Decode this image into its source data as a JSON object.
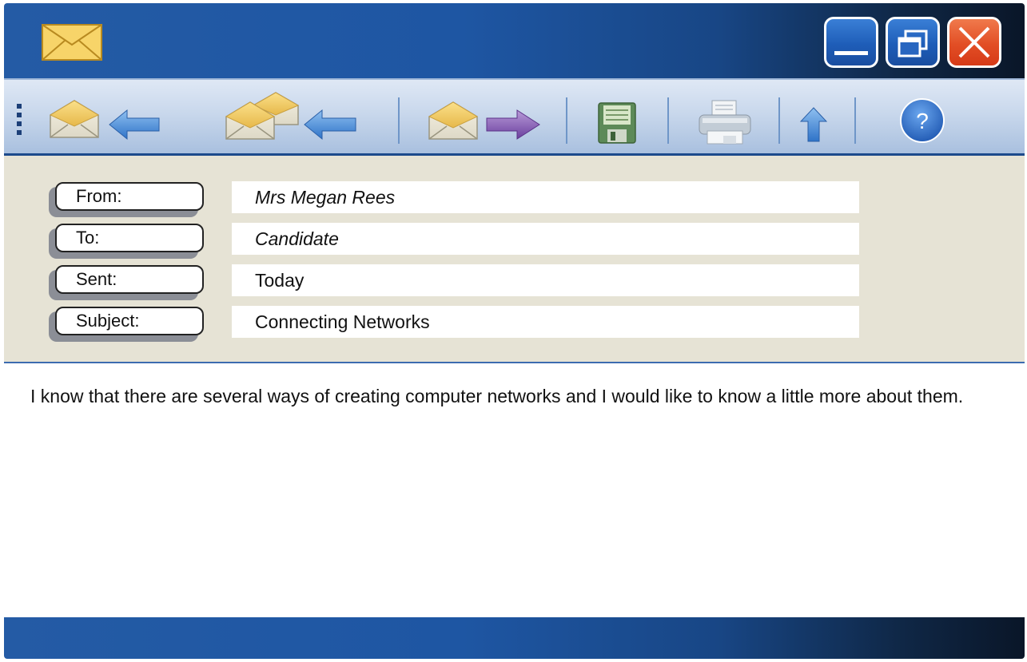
{
  "window": {
    "icons": {
      "app": "envelope-icon",
      "minimize": "minimize-icon",
      "maximize": "restore-window-icon",
      "close": "close-icon"
    },
    "colors": {
      "titlebar_start": "#245ba5",
      "titlebar_end": "#0a1628",
      "close_button": "#e24e25",
      "header_panel": "#e6e3d5"
    }
  },
  "toolbar": {
    "items": [
      {
        "name": "reply",
        "icon": "reply-envelope-icon"
      },
      {
        "name": "reply-all",
        "icon": "reply-all-envelopes-icon"
      },
      {
        "name": "forward",
        "icon": "forward-envelope-icon"
      },
      {
        "name": "save",
        "icon": "floppy-disk-icon"
      },
      {
        "name": "print",
        "icon": "printer-icon"
      },
      {
        "name": "up",
        "icon": "up-arrow-icon"
      },
      {
        "name": "help",
        "icon": "help-icon",
        "label": "?"
      }
    ]
  },
  "header": {
    "from": {
      "label": "From:",
      "value": "Mrs Megan Rees"
    },
    "to": {
      "label": "To:",
      "value": "Candidate"
    },
    "sent": {
      "label": "Sent:",
      "value": "Today"
    },
    "subject": {
      "label": "Subject:",
      "value": "Connecting Networks"
    }
  },
  "body": {
    "text": "I know that there are several ways of creating computer networks and I would like to know a little more about them."
  }
}
